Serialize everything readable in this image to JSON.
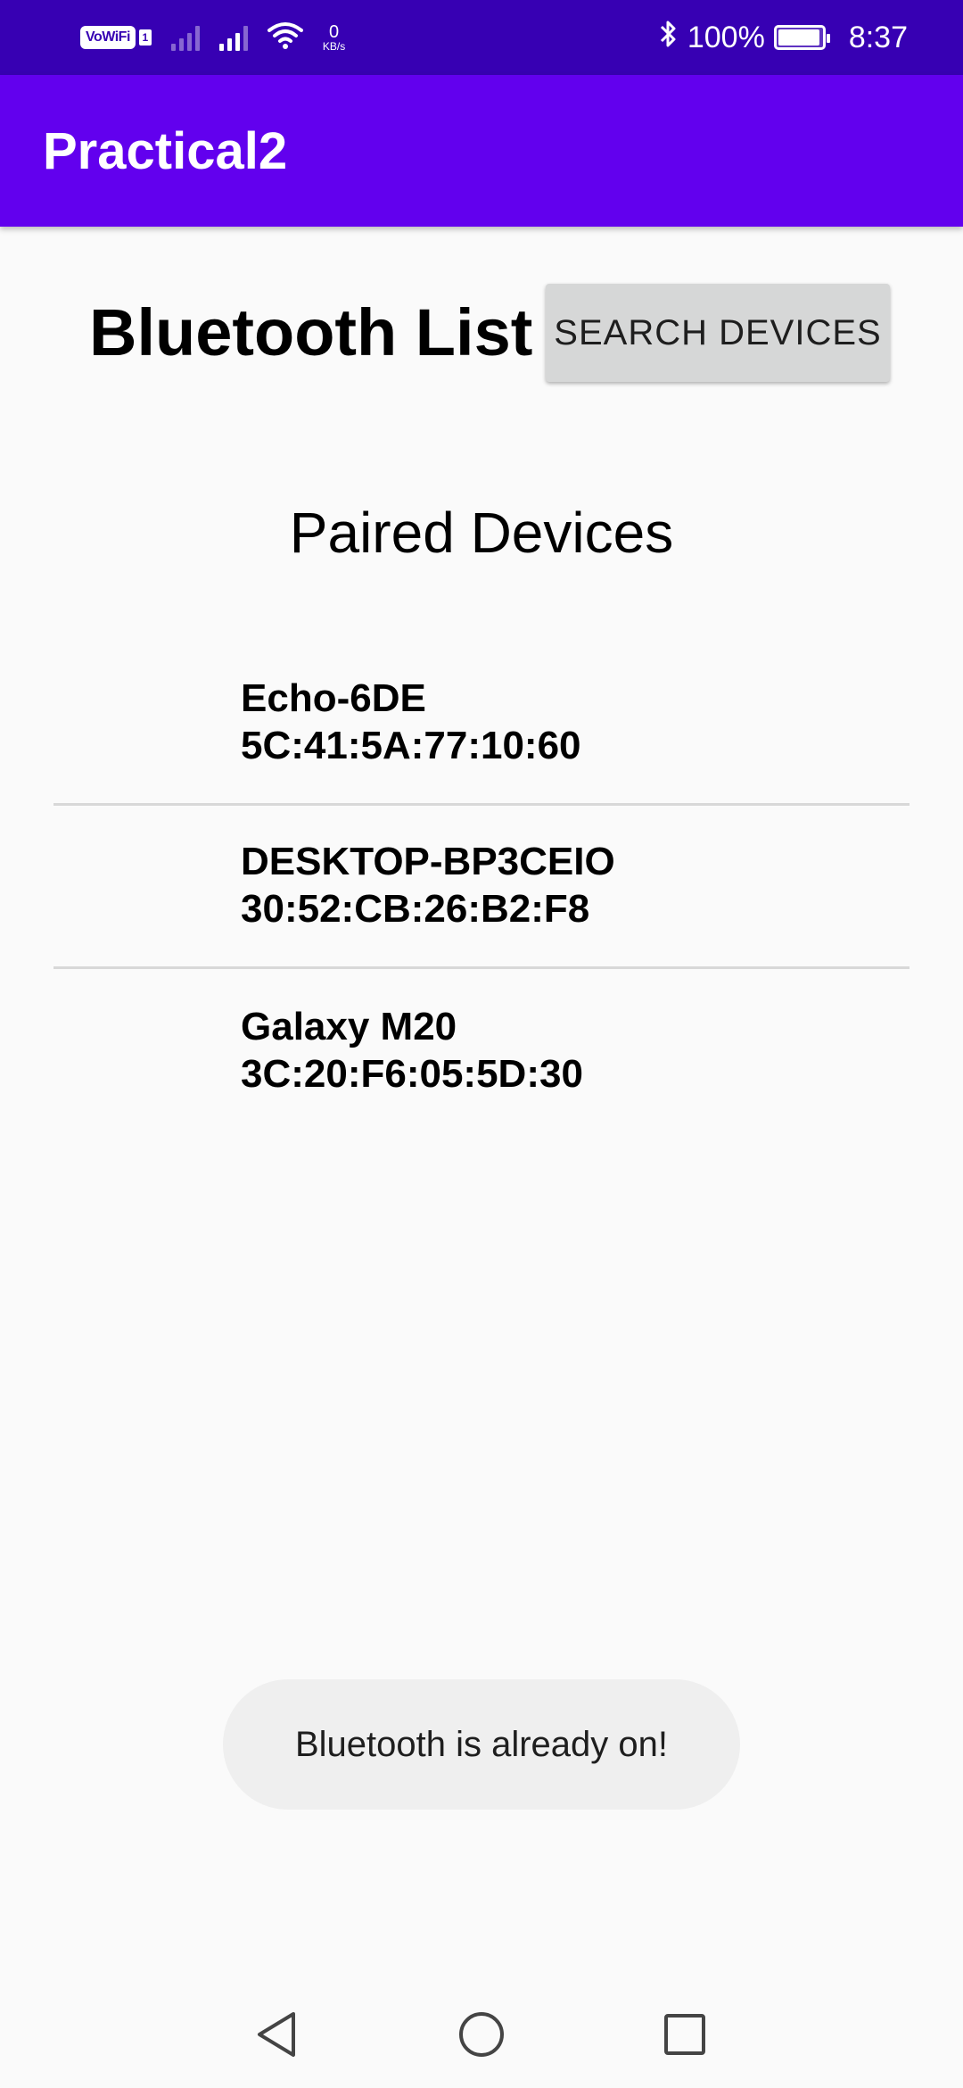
{
  "status_bar": {
    "vowifi_label": "VoWiFi",
    "vowifi_sub": "1",
    "net_speed_value": "0",
    "net_speed_unit": "KB/s",
    "battery_percent": "100%",
    "time": "8:37"
  },
  "app_bar": {
    "title": "Practical2"
  },
  "header": {
    "title": "Bluetooth List",
    "search_button_label": "SEARCH DEVICES"
  },
  "section": {
    "title": "Paired Devices"
  },
  "devices": [
    {
      "name": "Echo-6DE",
      "address": "5C:41:5A:77:10:60"
    },
    {
      "name": "DESKTOP-BP3CEIO",
      "address": "30:52:CB:26:B2:F8"
    },
    {
      "name": "Galaxy M20",
      "address": "3C:20:F6:05:5D:30"
    }
  ],
  "toast": {
    "message": "Bluetooth is already on!"
  },
  "colors": {
    "status_bar": "#3700b3",
    "app_bar": "#6200ee",
    "background": "#fafafa",
    "button": "#d6d7d7"
  },
  "icons": {
    "bluetooth": "bluetooth-icon",
    "wifi": "wifi-icon",
    "battery": "battery-charging-icon",
    "back": "back-triangle-icon",
    "home": "home-circle-icon",
    "recent": "recent-square-icon"
  }
}
